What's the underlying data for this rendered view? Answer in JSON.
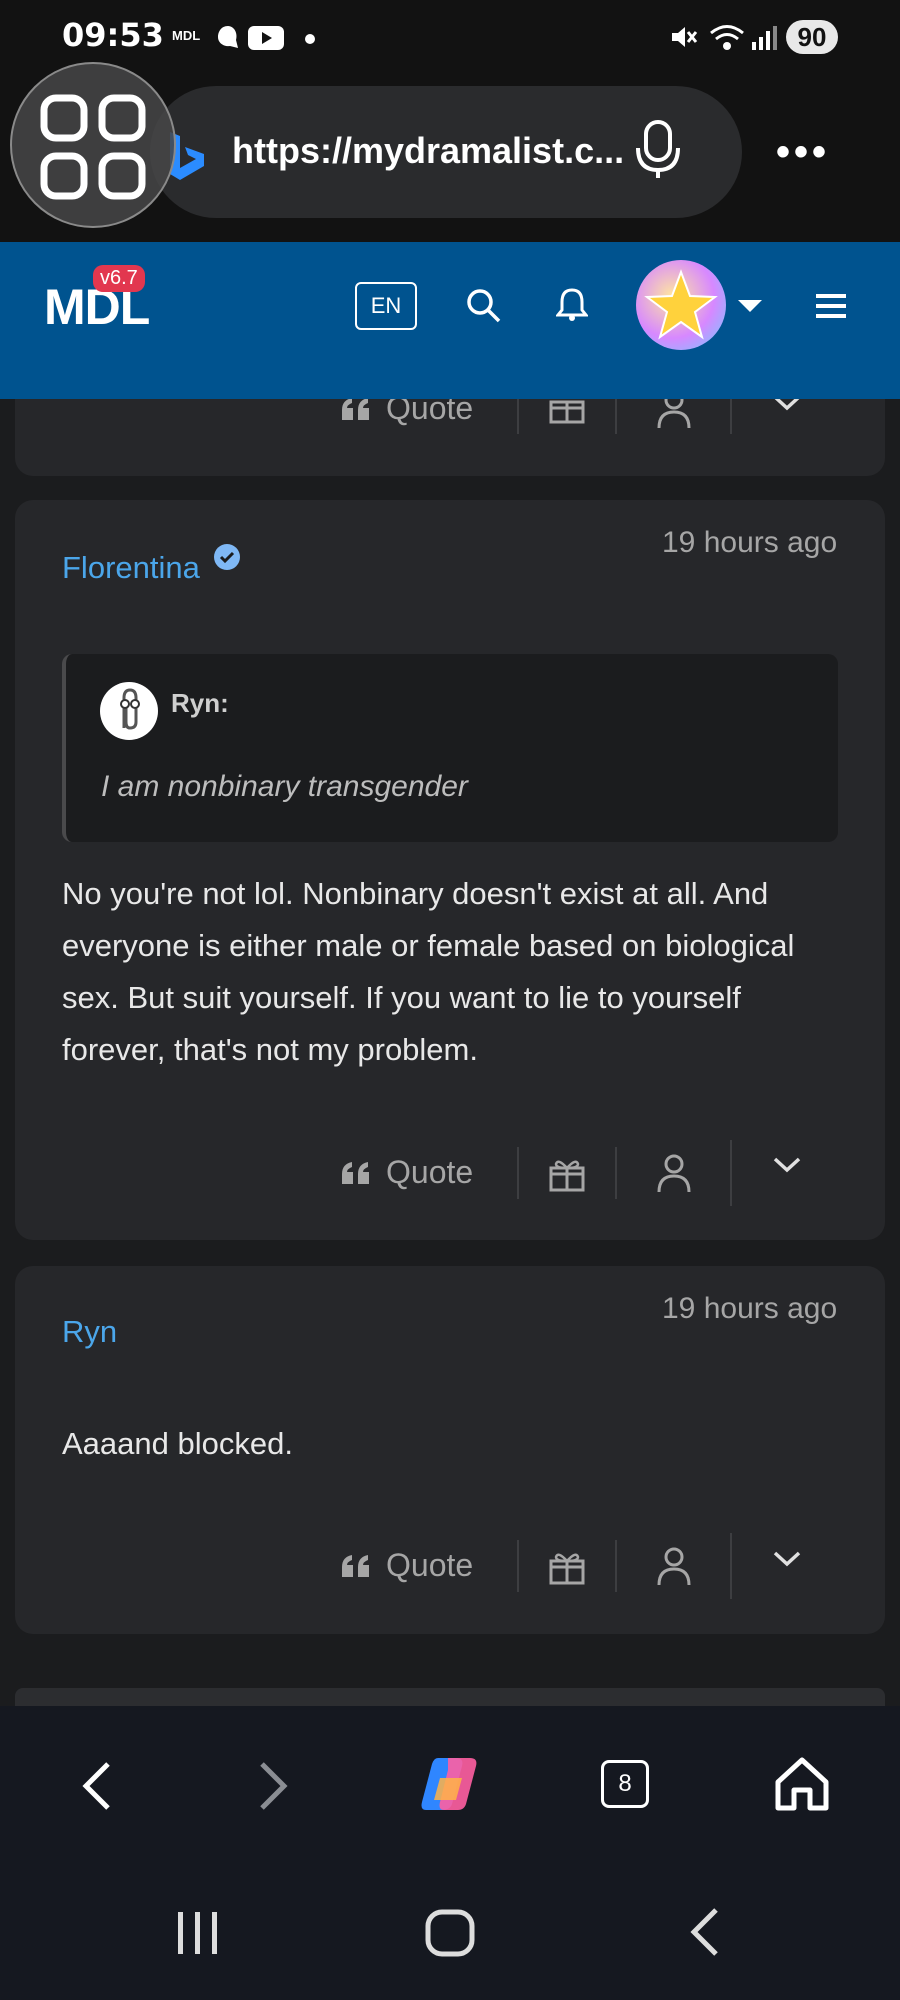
{
  "status": {
    "time": "09:53",
    "app_label": "MDL",
    "battery": "90"
  },
  "browser": {
    "url": "https://mydramalist.c...",
    "more_label": "•••",
    "tab_count": "8"
  },
  "site": {
    "logo": "MDL",
    "version": "v6.7",
    "language": "EN"
  },
  "comments": [
    {
      "author": "Florentina",
      "verified": true,
      "time": "19 hours ago",
      "quote": {
        "author": "Ryn:",
        "text": "I am nonbinary transgender"
      },
      "lines": [
        "No you're not lol. Nonbinary doesn't exist at all. And",
        "everyone is either male or female based on biological",
        "sex. But suit yourself. If you want to lie to yourself",
        "forever, that's not my problem."
      ],
      "quote_label": "Quote"
    },
    {
      "author": "Ryn",
      "time": "19 hours ago",
      "text": "Aaaand blocked.",
      "quote_label": "Quote"
    }
  ],
  "previous_card": {
    "quote_label": "Quote"
  },
  "colors": {
    "header": "#00538f",
    "link": "#4ba6ea",
    "card": "#26272a",
    "background": "#1b1c1e"
  }
}
